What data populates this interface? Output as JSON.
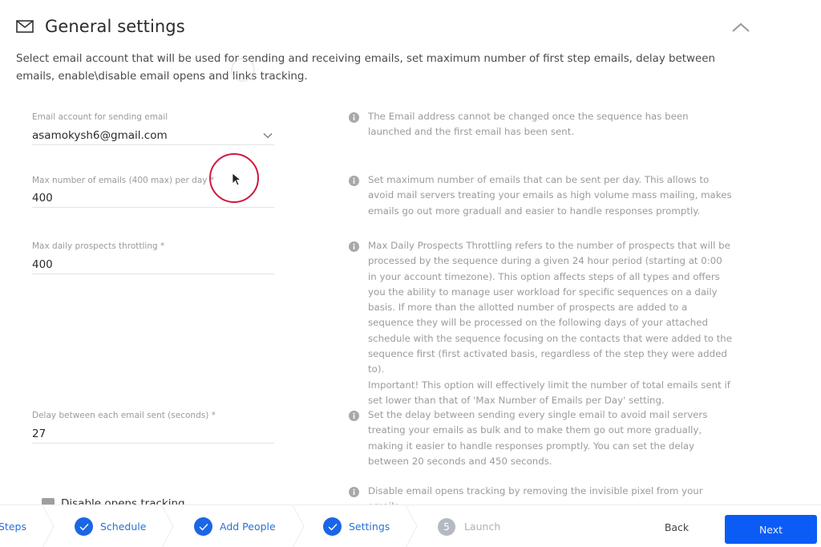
{
  "header": {
    "title": "General settings",
    "icon": "mail-icon",
    "collapse_icon": "chevron-up-icon"
  },
  "description": "Select email account that will be used for sending and receiving emails, set maximum number of first step emails, delay between emails, enable\\disable email opens and links tracking.",
  "fields": {
    "email_account": {
      "label": "Email account for sending email",
      "value": "asamokysh6@gmail.com"
    },
    "max_emails": {
      "label": "Max number of emails (400 max) per day *",
      "value": "400"
    },
    "max_prospects": {
      "label": "Max daily prospects throttling *",
      "value": "400"
    },
    "delay": {
      "label": "Delay between each email sent (seconds) *",
      "value": "27"
    }
  },
  "info": {
    "email_account": "The Email address cannot be changed once the sequence has been launched and the first email has been sent.",
    "max_emails": "Set maximum number of emails that can be sent per day. This allows to avoid mail servers treating your emails as high volume mass mailing, makes emails go out more graduall and easier to handle responses promptly.",
    "max_prospects": "Max Daily Prospects Throttling refers to the number of prospects that will be processed by the sequence during a given 24 hour period (starting at 0:00 in your account timezone). This option affects steps of all types and offers you the ability to manage user workload for specific sequences on a daily basis. If more than the allotted number of prospects are added to a sequence they will be processed on the following days of your attached schedule with the sequence focusing on the contacts that were added to the sequence first (first activated basis, regardless of the step they were added to).",
    "max_prospects_important": "Important! This option will effectively limit the number of total emails sent if set lower than that of 'Max Number of Emails per Day' setting.",
    "delay": "Set the delay between sending every single email to avoid mail servers treating your emails as bulk and to make them go out more gradually, making it easier to handle responses promptly. You can set the delay between 20 seconds and 450 seconds.",
    "opens_tracking": "Disable email opens tracking by removing the invisible pixel from your emails."
  },
  "toggles": {
    "disable_opens_tracking": "Disable opens tracking"
  },
  "stepper": {
    "steps": [
      {
        "label": "Steps",
        "state": "done"
      },
      {
        "label": "Schedule",
        "state": "done"
      },
      {
        "label": "Add People",
        "state": "done"
      },
      {
        "label": "Settings",
        "state": "done"
      },
      {
        "label": "Launch",
        "state": "pending",
        "number": "5"
      }
    ],
    "back_label": "Back",
    "next_label": "Next"
  },
  "colors": {
    "accent": "#0a5cf5",
    "step_done": "#1a66e6",
    "step_pending": "#b5b9c3",
    "click_indicator": "#d0173f"
  }
}
